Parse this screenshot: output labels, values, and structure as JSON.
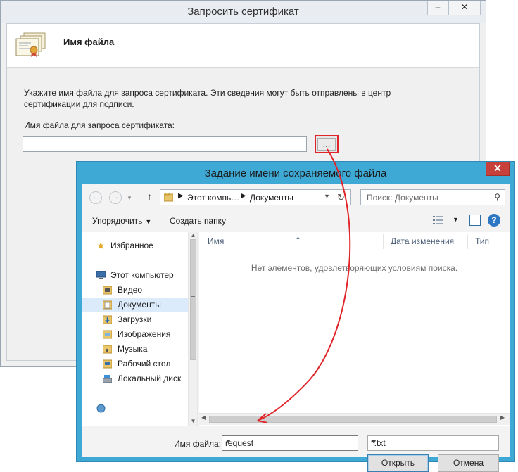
{
  "cert_dialog": {
    "title": "Запросить сертификат",
    "minimize_label": "–",
    "close_label": "✕",
    "header_title": "Имя файла",
    "description": "Укажите имя файла для запроса сертификата. Эти сведения могут быть отправлены в центр сертификации для подписи.",
    "field_label": "Имя файла для запроса сертификата:",
    "field_value": "",
    "browse_label": "..."
  },
  "save_dialog": {
    "title": "Задание имени сохраняемого файла",
    "close_label": "✕",
    "address": {
      "crumbs": [
        "Этот компь…",
        "Документы"
      ]
    },
    "search_placeholder": "Поиск: Документы",
    "toolbar": {
      "organize_label": "Упорядочить",
      "new_folder_label": "Создать папку"
    },
    "nav": [
      {
        "label": "Избранное",
        "icon": "star-icon"
      },
      {
        "label": "Этот компьютер",
        "icon": "computer-icon"
      },
      {
        "label": "Видео",
        "icon": "video-folder-icon"
      },
      {
        "label": "Документы",
        "icon": "documents-folder-icon",
        "selected": true
      },
      {
        "label": "Загрузки",
        "icon": "downloads-folder-icon"
      },
      {
        "label": "Изображения",
        "icon": "pictures-folder-icon"
      },
      {
        "label": "Музыка",
        "icon": "music-folder-icon"
      },
      {
        "label": "Рабочий стол",
        "icon": "desktop-folder-icon"
      },
      {
        "label": "Локальный диск",
        "icon": "disk-icon"
      }
    ],
    "columns": [
      "Имя",
      "Дата изменения",
      "Тип"
    ],
    "empty_message": "Нет элементов, удовлетворяющих условиям поиска.",
    "filename_label": "Имя файла:",
    "filename_value": "request",
    "filetype_value": "*.txt",
    "open_button": "Открыть",
    "cancel_button": "Отмена"
  },
  "colors": {
    "dialog_frame": "#3fa9d6",
    "highlight_red": "#e0242a",
    "selection": "#dcebfc"
  }
}
